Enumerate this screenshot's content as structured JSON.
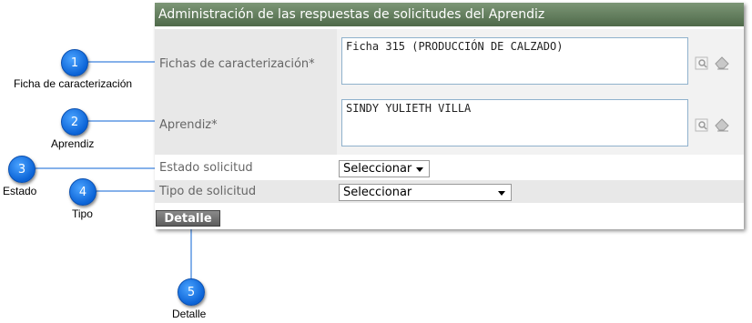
{
  "panel": {
    "title": "Administración de las respuestas de solicitudes del Aprendiz",
    "fields": {
      "fichas_label": "Fichas de caracterización*",
      "fichas_value": "Ficha 315 (PRODUCCIÓN DE CALZADO)",
      "aprendiz_label": "Aprendiz*",
      "aprendiz_value": "SINDY YULIETH VILLA",
      "estado_label": "Estado solicitud",
      "estado_value": "Seleccionar",
      "tipo_label": "Tipo de solicitud",
      "tipo_value": "Seleccionar"
    },
    "detalle_button": "Detalle"
  },
  "callouts": [
    {
      "number": "1",
      "label": "Ficha de caracterización"
    },
    {
      "number": "2",
      "label": "Aprendiz"
    },
    {
      "number": "3",
      "label": "Estado"
    },
    {
      "number": "4",
      "label": "Tipo"
    },
    {
      "number": "5",
      "label": "Detalle"
    }
  ],
  "colors": {
    "header_bg": "#5f7a59",
    "callout_blue": "#1a7bf0",
    "field_border": "#8fb1cc"
  }
}
